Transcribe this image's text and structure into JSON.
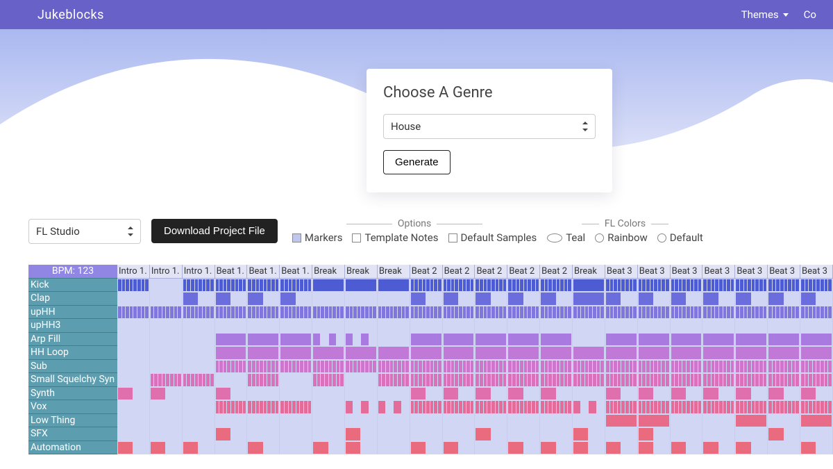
{
  "nav": {
    "brand": "Jukeblocks",
    "links": [
      "Themes",
      "Co"
    ]
  },
  "card": {
    "title": "Choose A Genre",
    "genre": "House",
    "generate": "Generate"
  },
  "controls": {
    "daw": "FL Studio",
    "download": "Download Project File",
    "options_legend": "Options",
    "options": [
      {
        "label": "Markers",
        "checked": true
      },
      {
        "label": "Template Notes",
        "checked": false
      },
      {
        "label": "Default Samples",
        "checked": false
      }
    ],
    "colors_legend": "FL Colors",
    "colors": [
      {
        "label": "Teal",
        "selected": true
      },
      {
        "label": "Rainbow",
        "selected": false
      },
      {
        "label": "Default",
        "selected": false
      }
    ]
  },
  "grid": {
    "bpm_label": "BPM: 123",
    "sections": [
      "Intro 1.",
      "Intro 1.",
      "Intro 1.",
      "Beat 1.",
      "Beat 1.",
      "Beat 1.",
      "Break",
      "Break",
      "Break",
      "Beat 2",
      "Beat 2",
      "Beat 2",
      "Beat 2",
      "Beat 2",
      "Break",
      "Beat 3",
      "Beat 3",
      "Beat 3",
      "Beat 3",
      "Beat 3",
      "Beat 3",
      "Beat 3"
    ],
    "tracks": [
      "Kick",
      "Clap",
      "upHH",
      "upHH3",
      "Arp Fill",
      "HH Loop",
      "Sub",
      "Small Squelchy Syn",
      "Synth",
      "Vox",
      "Low Thing",
      "SFX",
      "Automation"
    ],
    "palette": {
      "bg": "#d0d6f3",
      "rainbow": [
        "#4e5cd3",
        "#6a6ddb",
        "#8176de",
        "#9277de",
        "#a97adf",
        "#c079d7",
        "#ce76cb",
        "#da72bb",
        "#e06fad",
        "#e46c99",
        "#e86b8a",
        "#ea6b7d",
        "#ea6b7d"
      ]
    },
    "pattern": [
      [
        4,
        0,
        4,
        4,
        4,
        4,
        1,
        1,
        1,
        4,
        4,
        4,
        4,
        4,
        1,
        4,
        4,
        4,
        4,
        4,
        4,
        4
      ],
      [
        0,
        0,
        2,
        2,
        2,
        2,
        0,
        0,
        0,
        2,
        2,
        2,
        2,
        2,
        1,
        2,
        2,
        2,
        2,
        2,
        2,
        2
      ],
      [
        4,
        4,
        4,
        4,
        4,
        4,
        4,
        4,
        4,
        4,
        4,
        4,
        4,
        4,
        4,
        4,
        4,
        4,
        4,
        4,
        4,
        4
      ],
      [
        0,
        0,
        0,
        0,
        0,
        0,
        0,
        0,
        0,
        0,
        0,
        0,
        0,
        0,
        0,
        0,
        0,
        0,
        0,
        0,
        0,
        0
      ],
      [
        0,
        0,
        0,
        1,
        1,
        1,
        3,
        3,
        0,
        1,
        1,
        1,
        1,
        1,
        0,
        1,
        1,
        1,
        1,
        1,
        1,
        1
      ],
      [
        0,
        0,
        0,
        1,
        1,
        1,
        1,
        1,
        1,
        1,
        1,
        1,
        1,
        1,
        1,
        1,
        1,
        1,
        1,
        1,
        1,
        1
      ],
      [
        0,
        0,
        0,
        4,
        4,
        4,
        4,
        4,
        4,
        4,
        4,
        4,
        4,
        4,
        4,
        4,
        4,
        4,
        4,
        4,
        4,
        4
      ],
      [
        0,
        4,
        4,
        0,
        4,
        0,
        4,
        0,
        4,
        4,
        4,
        4,
        4,
        4,
        4,
        4,
        4,
        4,
        4,
        4,
        4,
        4
      ],
      [
        2,
        2,
        0,
        2,
        0,
        0,
        0,
        0,
        0,
        2,
        2,
        2,
        2,
        2,
        0,
        2,
        2,
        2,
        2,
        2,
        2,
        2
      ],
      [
        0,
        0,
        0,
        4,
        4,
        4,
        0,
        3,
        3,
        4,
        4,
        4,
        4,
        4,
        3,
        4,
        4,
        4,
        4,
        4,
        4,
        4
      ],
      [
        0,
        0,
        0,
        0,
        0,
        0,
        0,
        0,
        0,
        0,
        0,
        0,
        0,
        0,
        0,
        1,
        1,
        0,
        0,
        1,
        0,
        1
      ],
      [
        0,
        0,
        0,
        2,
        0,
        0,
        0,
        2,
        0,
        0,
        0,
        2,
        0,
        0,
        2,
        0,
        2,
        0,
        0,
        0,
        2,
        0
      ],
      [
        2,
        2,
        2,
        0,
        2,
        0,
        2,
        2,
        0,
        2,
        2,
        0,
        2,
        2,
        2,
        2,
        2,
        2,
        2,
        2,
        0,
        2
      ]
    ]
  }
}
